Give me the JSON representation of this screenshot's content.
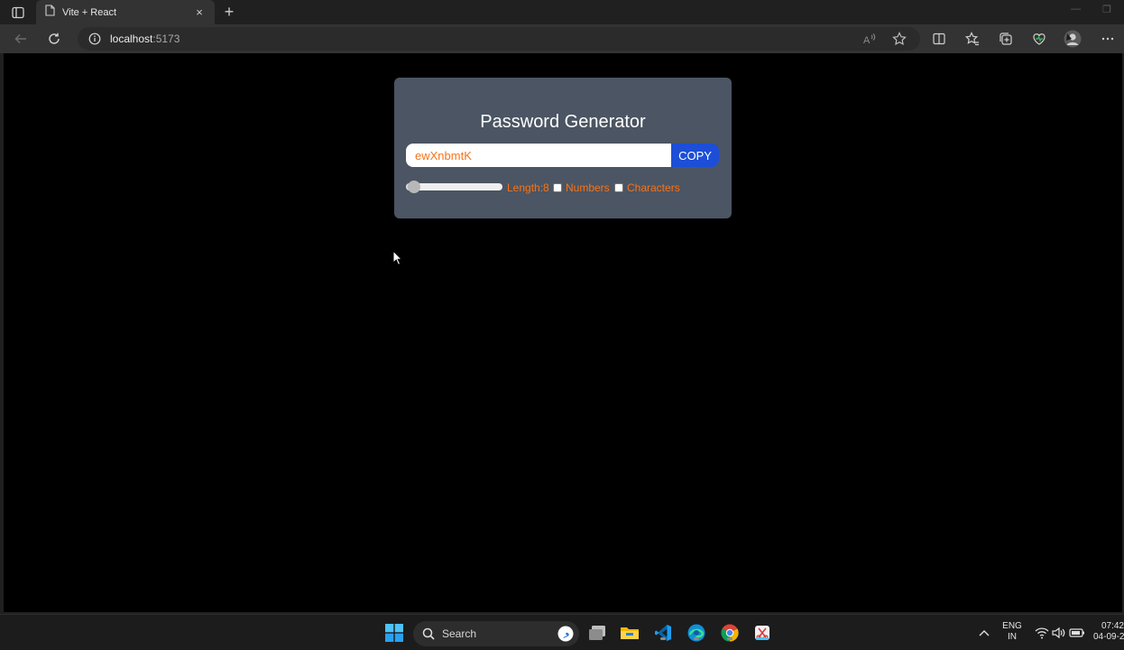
{
  "browser": {
    "tab_title": "Vite + React",
    "tab_close": "×",
    "new_tab": "+",
    "url_host": "localhost",
    "url_port": ":5173"
  },
  "app": {
    "title": "Password Generator",
    "password": "ewXnbmtK",
    "copy_label": "COPY",
    "length_label": "Length:8",
    "length_value": 8,
    "length_min": 6,
    "length_max": 100,
    "numbers_label": "Numbers",
    "numbers_checked": false,
    "characters_label": "Characters",
    "characters_checked": false
  },
  "taskbar": {
    "search_placeholder": "Search",
    "lang_line1": "ENG",
    "lang_line2": "IN",
    "time": "07:42",
    "date": "04-09-2"
  },
  "colors": {
    "card_bg": "#4b5563",
    "accent_orange": "#f97316",
    "copy_button": "#1d4ed8",
    "page_bg": "#000000"
  }
}
